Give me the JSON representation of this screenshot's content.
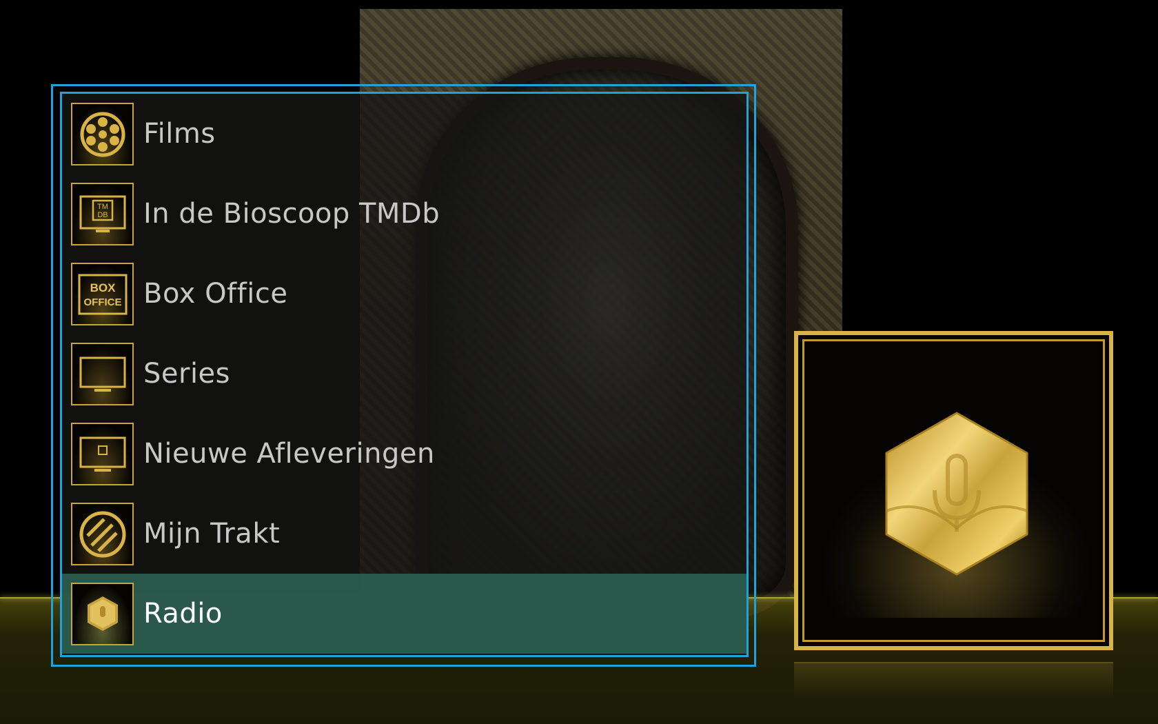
{
  "menu": {
    "items": [
      {
        "label": "Films",
        "icon": "film-reel-icon"
      },
      {
        "label": "In de Bioscoop TMDb",
        "icon": "tmdb-screen-icon"
      },
      {
        "label": "Box Office",
        "icon": "box-office-icon"
      },
      {
        "label": "Series",
        "icon": "tv-screen-icon"
      },
      {
        "label": "Nieuwe Afleveringen",
        "icon": "new-episodes-icon"
      },
      {
        "label": "Mijn Trakt",
        "icon": "trakt-icon"
      },
      {
        "label": "Radio",
        "icon": "radio-microphone-icon"
      }
    ],
    "selected_label": "Radio"
  },
  "thumb_text": {
    "tmdb_line1": "TM",
    "tmdb_line2": "DB",
    "box_line1": "BOX",
    "box_line2": "OFFICE"
  },
  "preview": {
    "icon": "radio-microphone-icon"
  },
  "colors": {
    "focus_border": "#20a2dd",
    "selected_row": "#2b5c4e",
    "gold": "#c9a33c"
  }
}
